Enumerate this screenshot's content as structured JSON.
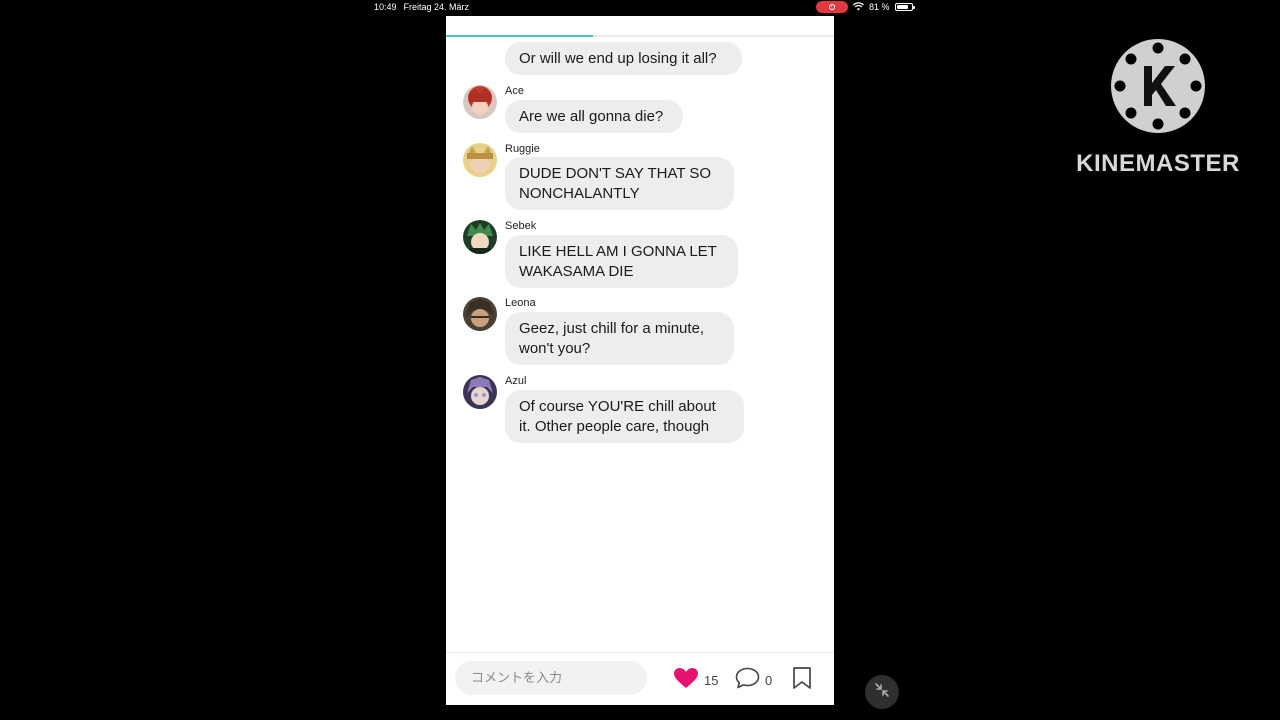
{
  "status_bar": {
    "time": "10:49",
    "date": "Freitag 24. März",
    "battery_percent": "81 %",
    "battery_level": 0.81
  },
  "chat": {
    "progress": 0.38,
    "messages": [
      {
        "sender": "",
        "text": "Or will we end up losing it all?"
      },
      {
        "sender": "Ace",
        "text": "Are we all gonna die?",
        "avatar_color": "#c0392b"
      },
      {
        "sender": "Ruggie",
        "text": "DUDE DON'T SAY THAT SO NONCHALANTLY",
        "avatar_color": "#e2b24a"
      },
      {
        "sender": "Sebek",
        "text": "LIKE HELL AM I GONNA LET WAKASAMA DIE",
        "avatar_color": "#2e5e3a"
      },
      {
        "sender": "Leona",
        "text": "Geez, just chill for a minute, won't you?",
        "avatar_color": "#6b5a45"
      },
      {
        "sender": "Azul",
        "text": "Of course YOU'RE chill about it. Other people care, though",
        "avatar_color": "#6a5a8c"
      }
    ]
  },
  "bottom_bar": {
    "comment_placeholder": "コメントを入力",
    "like_count": "15",
    "comment_count": "0",
    "like_color": "#e8136f"
  },
  "watermark": {
    "brand": "KINEMASTER"
  }
}
